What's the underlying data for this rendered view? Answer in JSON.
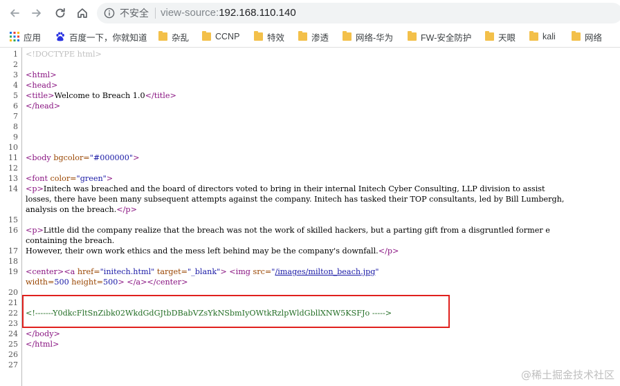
{
  "toolbar": {
    "security_label": "不安全",
    "url_scheme": "view-source:",
    "url_host": "192.168.110.140"
  },
  "bookmarks": [
    {
      "label": "应用",
      "icon": "apps-grid-icon"
    },
    {
      "label": "百度一下，你就知道",
      "icon": "baidu-paw-icon"
    },
    {
      "label": "杂乱",
      "icon": "folder-icon"
    },
    {
      "label": "CCNP",
      "icon": "folder-icon"
    },
    {
      "label": "特效",
      "icon": "folder-icon"
    },
    {
      "label": "渗透",
      "icon": "folder-icon"
    },
    {
      "label": "网络-华为",
      "icon": "folder-icon"
    },
    {
      "label": "FW-安全防护",
      "icon": "folder-icon"
    },
    {
      "label": "天眼",
      "icon": "folder-icon"
    },
    {
      "label": "kali",
      "icon": "folder-icon"
    },
    {
      "label": "网络",
      "icon": "folder-icon"
    }
  ],
  "source": {
    "line_numbers": [
      "1",
      "2",
      "3",
      "4",
      "5",
      "6",
      "7",
      "8",
      "9",
      "10",
      "11",
      "12",
      "13",
      "14",
      "15",
      "16",
      "17",
      "18",
      "19",
      "20",
      "21",
      "22",
      "23",
      "24",
      "25",
      "26",
      "27"
    ],
    "doctype": "<!DOCTYPE html>",
    "html_open": "<html>",
    "head_open": "<head>",
    "title_open": "<title>",
    "title_text": "Welcome to Breach 1.0",
    "title_close": "</title>",
    "head_close": "</head>",
    "body_tag": "<body",
    "body_attr": " bgcolor=",
    "body_val": "\"#000000\"",
    "body_end": ">",
    "font_tag": "<font",
    "font_attr": " color=",
    "font_val": "\"green\"",
    "font_end": ">",
    "p_open": "<p>",
    "p1_line1": "Initech was breached and the board of directors voted to bring in their internal Initech Cyber Consulting, LLP division to assist",
    "p1_line2": "losses, there have been many subsequent attempts against the company. Initech has tasked their TOP consultants, led by Bill Lumbergh,",
    "p1_line3": "analysis on the breach.",
    "p_close": "</p>",
    "p2_line1": "Little did the company realize that the breach was not the work of skilled hackers, but a parting gift from a disgruntled former e",
    "p2_line2": "containing the breach.",
    "p2_line3": "However, their own work ethics and the mess left behind may be the company's downfall.",
    "center_open": "<center>",
    "a_tag": "<a",
    "a_href_attr": " href=",
    "a_href_val": "\"initech.html\"",
    "a_target_attr": " target=",
    "a_target_val": "\"_blank\"",
    "a_end": ">",
    "img_tag": "<img",
    "img_src_attr": " src=",
    "img_src_q1": "\"",
    "img_src_link": "/images/milton_beach.jpg",
    "img_src_q2": "\"",
    "img_width_attr": "width=",
    "img_width_val": "500",
    "img_height_attr": " height=",
    "img_height_val": "500",
    "img_end": ">",
    "a_center_close": "</a></center>",
    "comment": "<!-------Y0dkcFltSnZibk02WkdGdGJtbDBabVZsYkNSbmIyOWtkRzlpWldGbllXNW5KSFJo ----->",
    "body_close": "</body>",
    "html_close": "</html>"
  },
  "watermark": "@稀土掘金技术社区"
}
